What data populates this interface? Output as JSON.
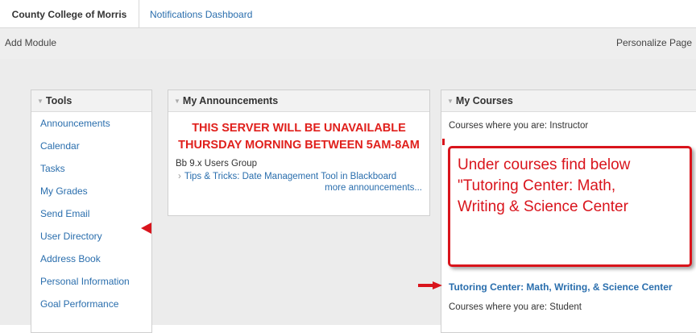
{
  "tabs": [
    {
      "label": "County College of Morris"
    },
    {
      "label": "Notifications Dashboard"
    }
  ],
  "toolbar": {
    "add_module": "Add Module",
    "personalize": "Personalize Page"
  },
  "tools": {
    "title": "Tools",
    "items": [
      "Announcements",
      "Calendar",
      "Tasks",
      "My Grades",
      "Send Email",
      "User Directory",
      "Address Book",
      "Personal Information",
      "Goal Performance"
    ]
  },
  "announcements": {
    "title": "My Announcements",
    "alert_line1": "THIS SERVER WILL BE UNAVAILABLE",
    "alert_line2": "THURSDAY MORNING BETWEEN 5AM-8AM",
    "group": "Bb 9.x Users Group",
    "tip": "Tips & Tricks: Date Management Tool in Blackboard",
    "more": "more announcements..."
  },
  "courses": {
    "title": "My Courses",
    "instructor_label": "Courses where you are: Instructor",
    "course_link": "Tutoring Center: Math, Writing, & Science Center",
    "student_label": "Courses where you are: Student"
  },
  "callout": {
    "line1": "Under courses find below",
    "line2": "\"Tutoring Center: Math,",
    "line3": "Writing & Science Center"
  },
  "colors": {
    "link": "#2a6ead",
    "alert": "#e0201c",
    "annotation": "#d9141c"
  }
}
